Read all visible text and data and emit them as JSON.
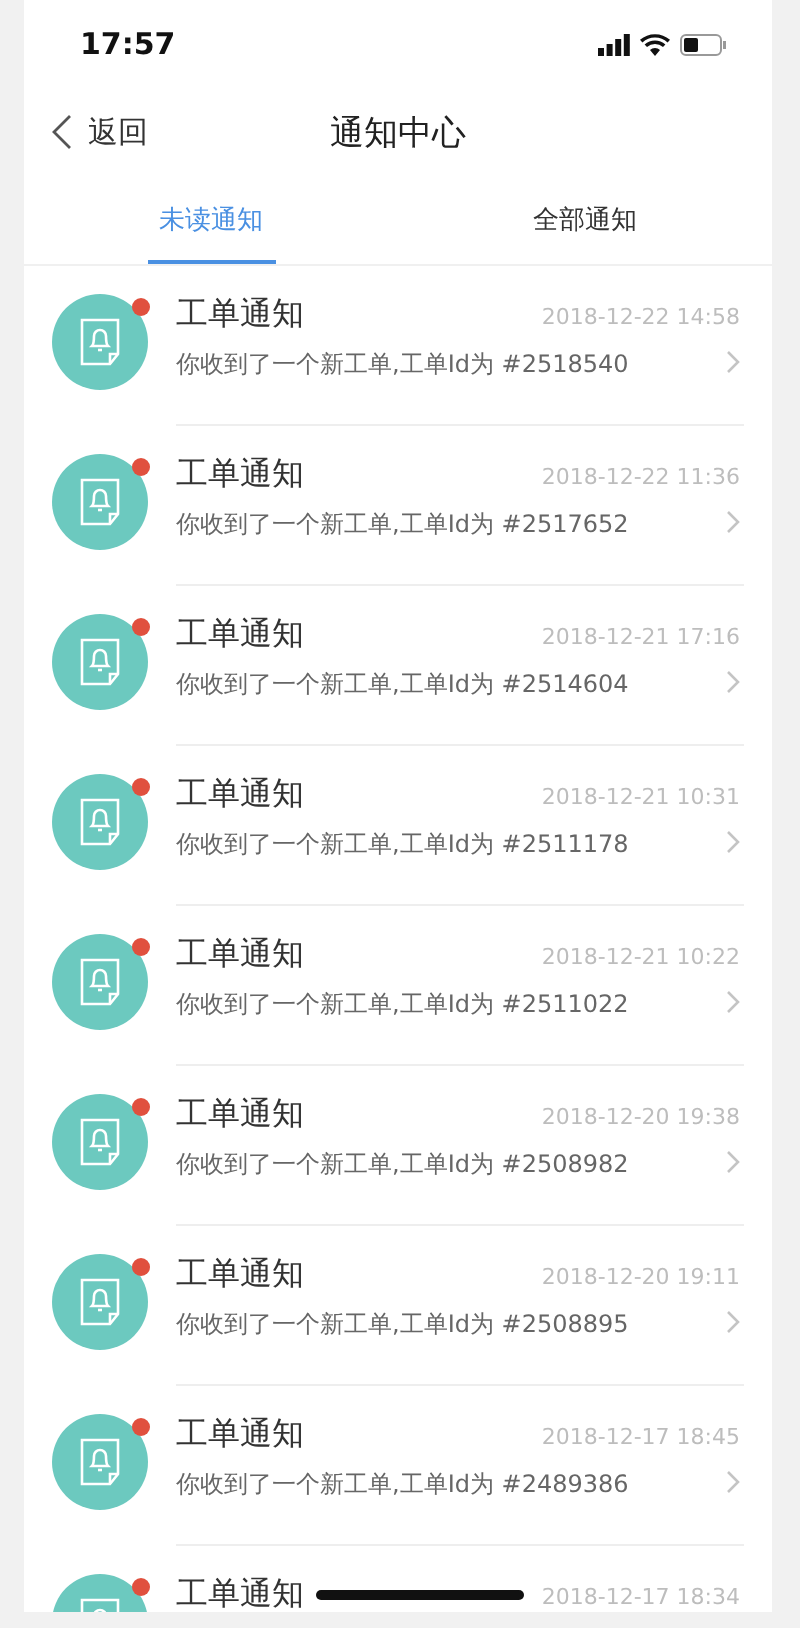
{
  "status_bar": {
    "time": "17:57"
  },
  "nav": {
    "back": "返回",
    "title": "通知中心"
  },
  "tabs": [
    {
      "label": "未读通知",
      "selected": true
    },
    {
      "label": "全部通知",
      "selected": false
    }
  ],
  "notifications": [
    {
      "title": "工单通知",
      "date": "2018-12-22 14:58",
      "message": "你收到了一个新工单,工单Id为 #2518540",
      "unread": true
    },
    {
      "title": "工单通知",
      "date": "2018-12-22 11:36",
      "message": "你收到了一个新工单,工单Id为 #2517652",
      "unread": true
    },
    {
      "title": "工单通知",
      "date": "2018-12-21 17:16",
      "message": "你收到了一个新工单,工单Id为 #2514604",
      "unread": true
    },
    {
      "title": "工单通知",
      "date": "2018-12-21 10:31",
      "message": "你收到了一个新工单,工单Id为 #2511178",
      "unread": true
    },
    {
      "title": "工单通知",
      "date": "2018-12-21 10:22",
      "message": "你收到了一个新工单,工单Id为 #2511022",
      "unread": true
    },
    {
      "title": "工单通知",
      "date": "2018-12-20 19:38",
      "message": "你收到了一个新工单,工单Id为 #2508982",
      "unread": true
    },
    {
      "title": "工单通知",
      "date": "2018-12-20 19:11",
      "message": "你收到了一个新工单,工单Id为 #2508895",
      "unread": true
    },
    {
      "title": "工单通知",
      "date": "2018-12-17 18:45",
      "message": "你收到了一个新工单,工单Id为 #2489386",
      "unread": true
    },
    {
      "title": "工单通知",
      "date": "2018-12-17 18:34",
      "unread": true
    }
  ]
}
